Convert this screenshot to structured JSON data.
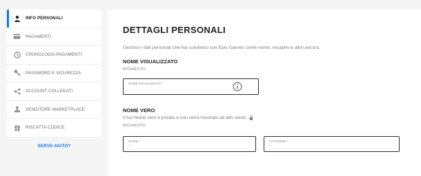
{
  "sidebar": {
    "items": [
      {
        "label": "INFO PERSONALI",
        "icon": "user-icon",
        "active": true
      },
      {
        "label": "PAGAMENTI",
        "icon": "card-icon",
        "active": false
      },
      {
        "label": "CRONOLOGIA PAGAMENTI",
        "icon": "history-icon",
        "active": false
      },
      {
        "label": "PASSWORD E SICUREZZA",
        "icon": "key-icon",
        "active": false
      },
      {
        "label": "ACCOUNT COLLEGATI",
        "icon": "share-icon",
        "active": false
      },
      {
        "label": "VENDITORE MARKETPLACE",
        "icon": "stamp-icon",
        "active": false
      },
      {
        "label": "RISCATTA CODICE",
        "icon": "gift-icon",
        "active": false
      }
    ],
    "help": "SERVE AIUTO?"
  },
  "main": {
    "title": "DETTAGLI PERSONALI",
    "description": "Gestisci i dati personali che hai condiviso con Epic Games come nome, recapito e altro ancora.",
    "display_name": {
      "heading": "NOME VISUALIZZATO",
      "required": "RICHIESTO",
      "field_label": "NOME VISUALIZZATO *",
      "field_value": ""
    },
    "real_name": {
      "heading": "NOME VERO",
      "description": "Il tuo Nome vero è privato e non verrà mostrato ad altri utenti.",
      "required": "RICHIESTO",
      "first_name_label": "NOME *",
      "first_name_value": "-",
      "last_name_label": "COGNOME *",
      "last_name_value": "-"
    }
  },
  "colors": {
    "accent": "#0078f2",
    "background": "#f5f5f5",
    "panel": "#ffffff"
  }
}
